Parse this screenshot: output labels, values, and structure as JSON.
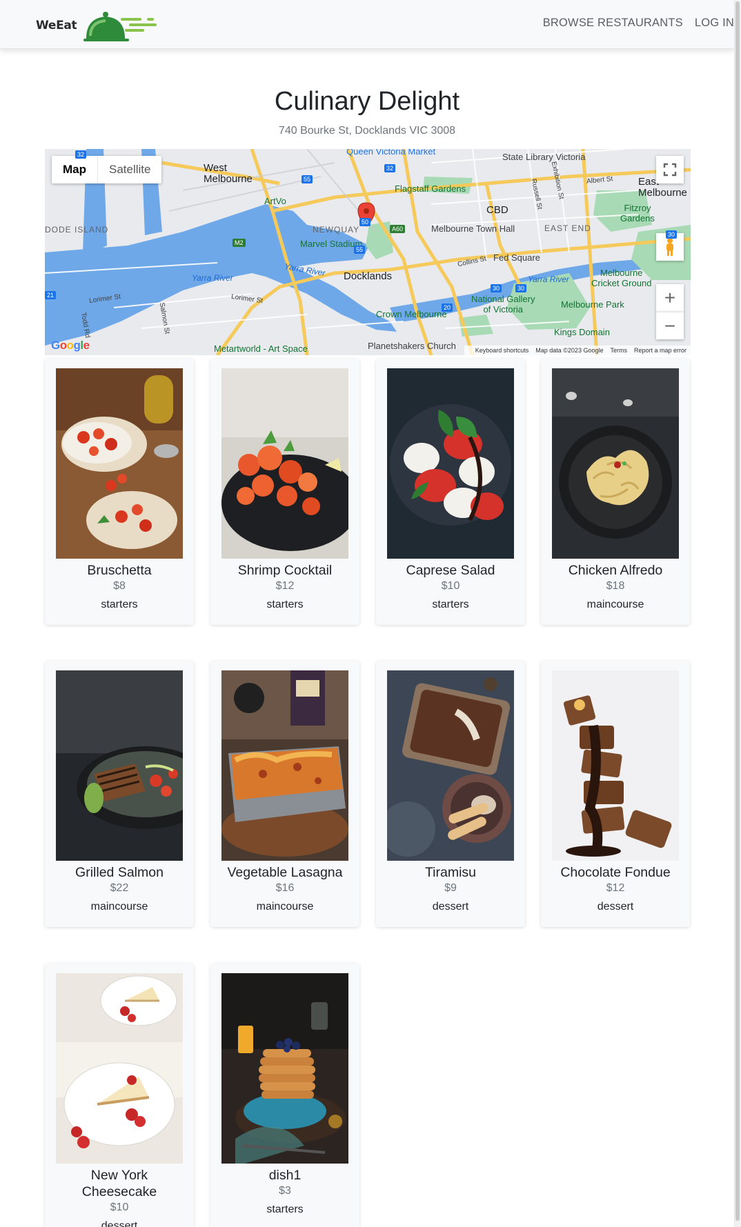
{
  "navbar": {
    "brand": "WeEat",
    "links": [
      "BROWSE RESTAURANTS",
      "LOG IN"
    ]
  },
  "restaurant": {
    "name": "Culinary Delight",
    "address": "740 Bourke St, Docklands VIC 3008"
  },
  "map": {
    "type_buttons": [
      "Map",
      "Satellite"
    ],
    "active_type": "Map",
    "zoom_in": "+",
    "zoom_out": "−",
    "places": {
      "west_melbourne": "West\nMelbourne",
      "queen_victoria": "Queen Victoria Market",
      "state_library": "State Library Victoria",
      "flagstaff": "Flagstaff Gardens",
      "cbd": "CBD",
      "east_melbourne": "East\nMelbourne",
      "fitzroy_gardens": "Fitzroy\nGardens",
      "east_end": "EAST END",
      "town_hall": "Melbourne Town Hall",
      "newquay": "NEWQUAY",
      "marvel": "Marvel Stadium",
      "artvo": "ArtVo",
      "dode_island": "DODE ISLAND",
      "yarra_river_1": "Yarra River",
      "yarra_river_2": "Yarra River",
      "yarra_river_3": "Yarra River",
      "docklands": "Docklands",
      "fed_square": "Fed Square",
      "cricket_ground": "Melbourne\nCricket Ground",
      "national_gallery": "National Gallery\nof Victoria",
      "melbourne_park": "Melbourne Park",
      "crown": "Crown Melbourne",
      "kings_domain": "Kings Domain",
      "metartworld": "Metartworld - Art Space",
      "planetshakers": "Planetshakers Church",
      "lorimer_1": "Lorimer St",
      "lorimer_2": "Lorimer St",
      "salmon": "Salmon St",
      "todd": "Todd Rd",
      "collins": "Collins St",
      "russell": "Russell St",
      "exhibition": "Exhibition St",
      "albert": "Albert St"
    },
    "footer": [
      "Keyboard shortcuts",
      "Map data ©2023 Google",
      "Terms",
      "Report a map error"
    ],
    "logo": "Google",
    "road_shields": [
      "32",
      "55",
      "32",
      "50",
      "M2",
      "55",
      "A60",
      "30",
      "20",
      "30",
      "30",
      "21"
    ]
  },
  "dishes": [
    {
      "name": "Bruschetta",
      "price": "$8",
      "category": "starters"
    },
    {
      "name": "Shrimp Cocktail",
      "price": "$12",
      "category": "starters"
    },
    {
      "name": "Caprese Salad",
      "price": "$10",
      "category": "starters"
    },
    {
      "name": "Chicken Alfredo",
      "price": "$18",
      "category": "maincourse"
    },
    {
      "name": "Grilled Salmon",
      "price": "$22",
      "category": "maincourse"
    },
    {
      "name": "Vegetable Lasagna",
      "price": "$16",
      "category": "maincourse"
    },
    {
      "name": "Tiramisu",
      "price": "$9",
      "category": "dessert"
    },
    {
      "name": "Chocolate Fondue",
      "price": "$12",
      "category": "dessert"
    },
    {
      "name": "New York\nCheesecake",
      "price": "$10",
      "category": "dessert"
    },
    {
      "name": "dish1",
      "price": "$3",
      "category": "starters"
    }
  ],
  "colors": {
    "brand_green": "#2e8b3a",
    "navbar_bg": "#f8f9fa",
    "card_bg": "#f8f9fa",
    "map_water": "#6fa8e8",
    "map_park": "#a8dab5",
    "map_road": "#f5c95a",
    "map_pin": "#ea4335"
  }
}
